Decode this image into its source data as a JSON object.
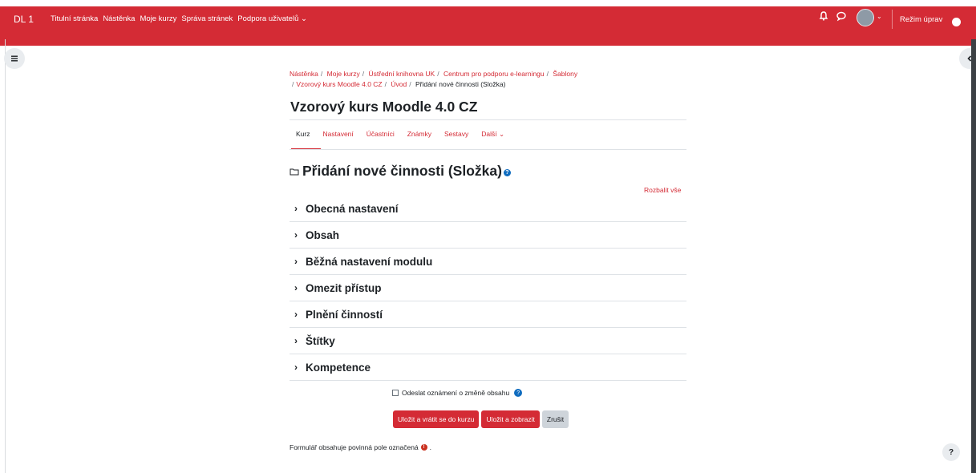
{
  "header": {
    "brand": "DL 1",
    "nav": [
      "Titulní stránka",
      "Nástěnka",
      "Moje kurzy",
      "Správa stránek",
      "Podpora uživatelů ⌄"
    ],
    "edit_mode_label": "Režim úprav",
    "accent": "#d42b35"
  },
  "breadcrumb": {
    "items": [
      "Nástěnka",
      "Moje kurzy",
      "Ústřední knihovna UK",
      "Centrum pro podporu e-learningu",
      "Šablony",
      "Vzorový kurs Moodle 4.0 CZ",
      "Úvod"
    ],
    "current": "Přidání nové činnosti (Složka)"
  },
  "course_title": "Vzorový kurs Moodle 4.0 CZ",
  "tabs": [
    "Kurz",
    "Nastavení",
    "Účastníci",
    "Známky",
    "Sestavy",
    "Další ⌄"
  ],
  "page_heading": "Přidání nové činnosti (Složka)",
  "expand_all": "Rozbalit vše",
  "sections": [
    "Obecná nastavení",
    "Obsah",
    "Běžná nastavení modulu",
    "Omezit přístup",
    "Plnění činností",
    "Štítky",
    "Kompetence"
  ],
  "notify_label": "Odeslat oznámení o změně obsahu",
  "buttons": {
    "save_return": "Uložit a vrátit se do kurzu",
    "save_display": "Uložit a zobrazit",
    "cancel": "Zrušit"
  },
  "required_note": "Formulář obsahuje povinná pole označená",
  "required_note_end": ".",
  "help_button": "?"
}
